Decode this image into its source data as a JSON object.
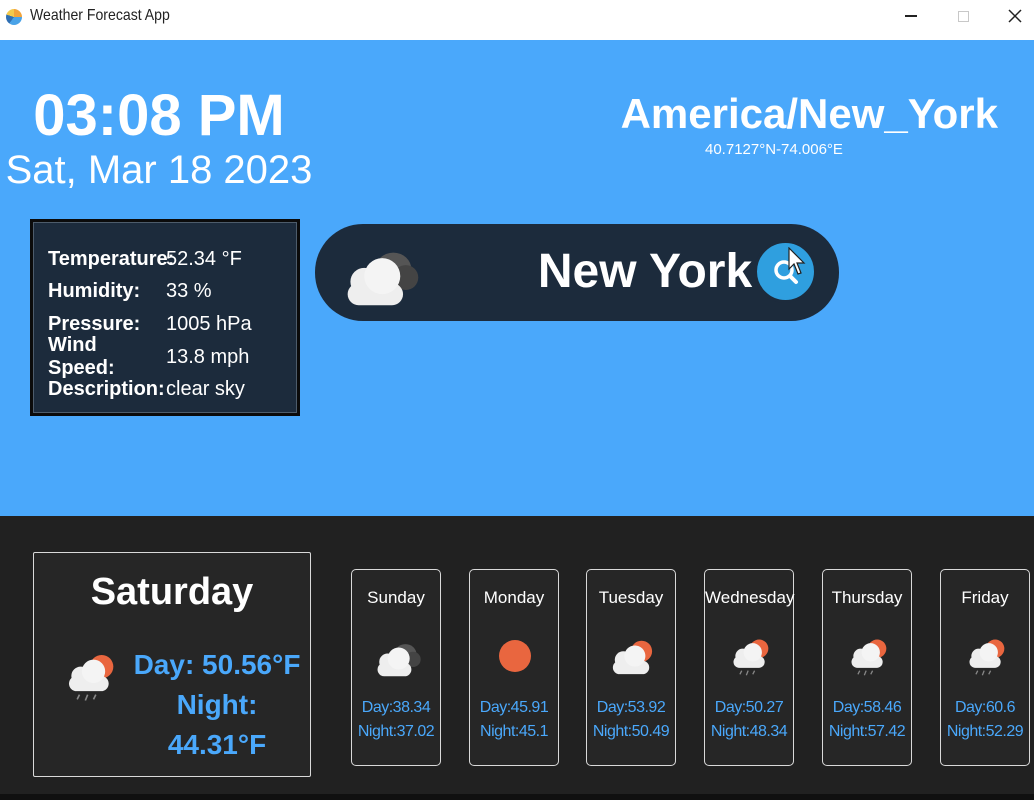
{
  "window": {
    "title": "Weather Forecast App"
  },
  "header": {
    "time": "03:08 PM",
    "date": "Sat, Mar 18 2023",
    "timezone": "America/New_York",
    "coordinates": "40.7127°N-74.006°E"
  },
  "details": {
    "temperature_label": "Temperature:",
    "temperature_value": "52.34 °F",
    "humidity_label": "Humidity:",
    "humidity_value": "33 %",
    "pressure_label": "Pressure:",
    "pressure_value": "1005 hPa",
    "wind_label": "Wind Speed:",
    "wind_value": "13.8 mph",
    "description_label": "Description:",
    "description_value": "clear sky"
  },
  "search": {
    "value": "New York",
    "icon": "cloud-icon",
    "button_icon": "search-icon"
  },
  "today": {
    "day": "Saturday",
    "day_temp": "Day: 50.56°F",
    "night_temp": "Night: 44.31°F",
    "icon": "sun-cloud-rain-icon"
  },
  "forecast": [
    {
      "day": "Sunday",
      "day_temp": "Day:38.34",
      "night_temp": "Night:37.02",
      "icon": "cloud-icon"
    },
    {
      "day": "Monday",
      "day_temp": "Day:45.91",
      "night_temp": "Night:45.1",
      "icon": "sun-icon"
    },
    {
      "day": "Tuesday",
      "day_temp": "Day:53.92",
      "night_temp": "Night:50.49",
      "icon": "sun-cloud-icon"
    },
    {
      "day": "Wednesday",
      "day_temp": "Day:50.27",
      "night_temp": "Night:48.34",
      "icon": "sun-cloud-rain-icon"
    },
    {
      "day": "Thursday",
      "day_temp": "Day:58.46",
      "night_temp": "Night:57.42",
      "icon": "sun-cloud-rain-icon"
    },
    {
      "day": "Friday",
      "day_temp": "Day:60.6",
      "night_temp": "Night:52.29",
      "icon": "sun-cloud-rain-icon"
    }
  ],
  "colors": {
    "sky": "#4aa8fb",
    "panel": "#1c2b3c",
    "bottom": "#212121",
    "accent": "#2f9fdf",
    "sun": "#e9663f"
  }
}
